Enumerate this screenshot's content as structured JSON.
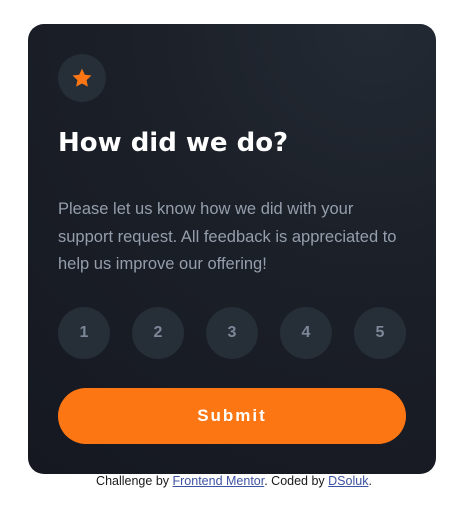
{
  "colors": {
    "card_background": "#1b1f27",
    "circle_background": "#262e38",
    "accent_orange": "#fc7614",
    "text_muted": "#959eac",
    "rating_text": "#7c8798",
    "link": "#3e52a3"
  },
  "card": {
    "icon": "star-icon",
    "title": "How did we do?",
    "description": "Please let us know how we did with your support request. All feedback is appreciated to help us improve our offering!",
    "ratings": [
      "1",
      "2",
      "3",
      "4",
      "5"
    ],
    "submit_label": "Submit"
  },
  "attribution": {
    "prefix": "Challenge by ",
    "mentor_link": "Frontend Mentor",
    "middle": ". Coded by ",
    "author_link": "DSoluk",
    "suffix": "."
  }
}
